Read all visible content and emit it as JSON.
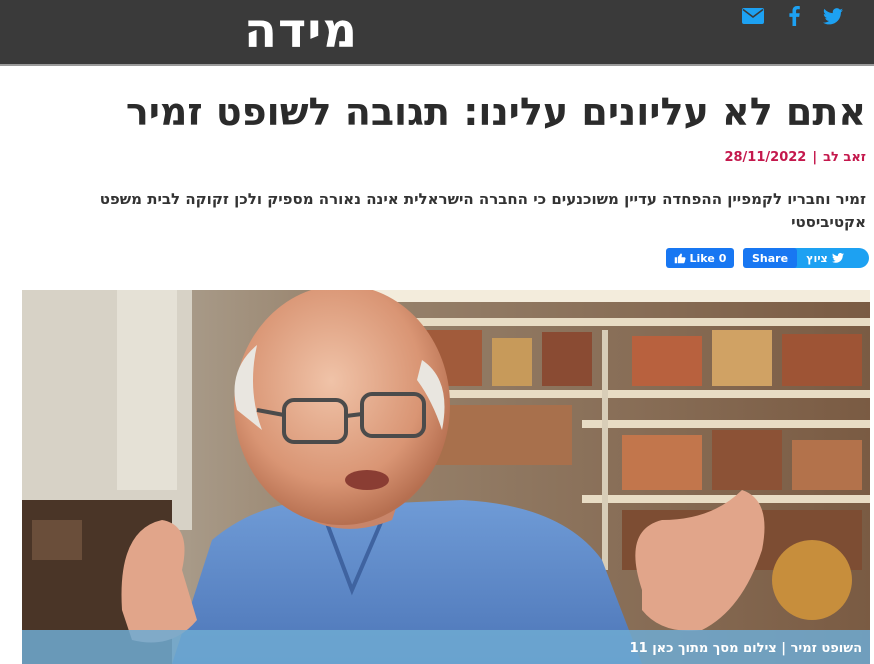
{
  "header": {
    "logo_text": "מידה",
    "social": [
      {
        "icon": "twitter-icon",
        "color": "#1da1f2"
      },
      {
        "icon": "facebook-icon",
        "color": "#1da1f2"
      },
      {
        "icon": "mail-icon",
        "color": "#1da1f2"
      }
    ]
  },
  "article": {
    "title": "אתם לא עליונים עלינו: תגובה לשופט זמיר",
    "author": "זאב לב",
    "date": "28/11/2022",
    "separator": "|",
    "subtitle": "זמיר וחבריו לקמפיין ההפחדה עדיין משוכנעים כי החברה הישראלית אינה נאורה מספיק ולכן זקוקה לבית משפט אקטיביסטי"
  },
  "share": {
    "tweet_label": "ציוץ",
    "fb_share_label": "Share",
    "fb_like_label": "Like",
    "fb_like_count": "0"
  },
  "hero": {
    "caption": "השופט זמיר | צילום מסך מתוך כאן 11"
  },
  "colors": {
    "topbar": "#3a3a3a",
    "accent": "#c4184c",
    "twitter": "#1da1f2",
    "facebook": "#1877f2"
  }
}
